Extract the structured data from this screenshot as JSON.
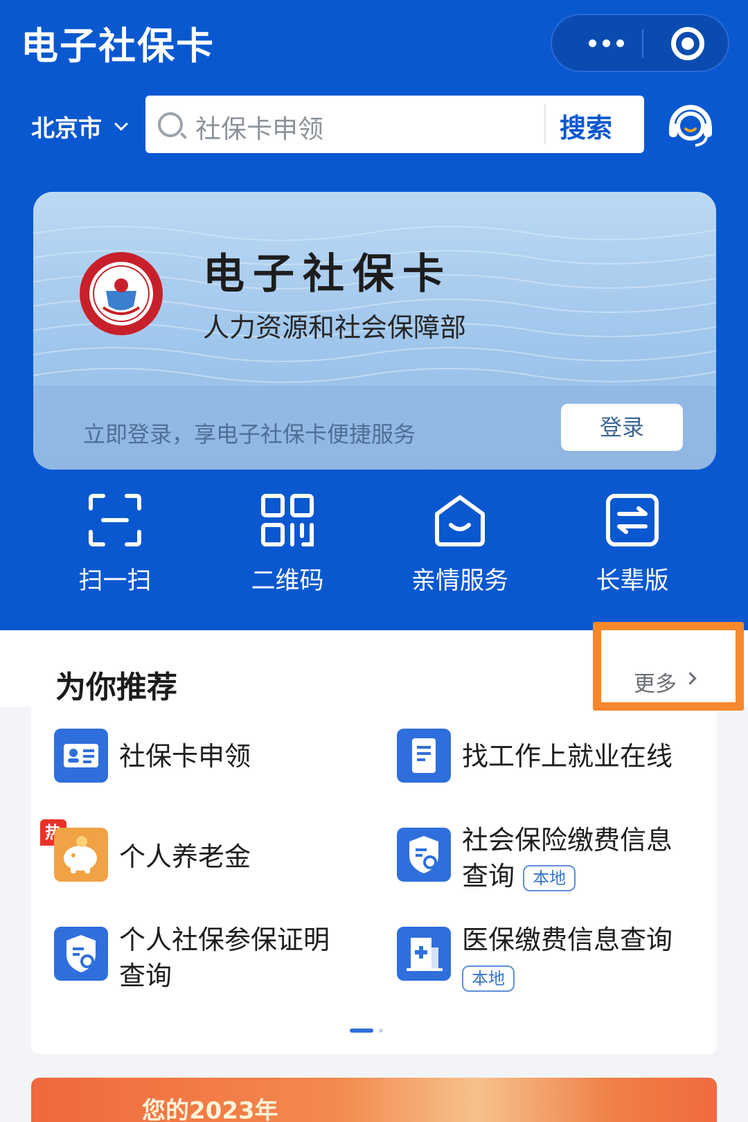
{
  "header": {
    "title": "电子社保卡",
    "menu_icon": "more-dots-icon",
    "close_icon": "target-close-icon"
  },
  "search": {
    "city": "北京市",
    "placeholder": "社保卡申领",
    "button": "搜索"
  },
  "banner": {
    "title": "电子社保卡",
    "subtitle": "人力资源和社会保障部",
    "tip": "立即登录，享电子社保卡便捷服务",
    "login_button": "登录"
  },
  "quick_actions": [
    {
      "label": "扫一扫",
      "icon": "scan-icon"
    },
    {
      "label": "二维码",
      "icon": "qr-code-icon"
    },
    {
      "label": "亲情服务",
      "icon": "family-home-icon"
    },
    {
      "label": "长辈版",
      "icon": "elder-mode-icon"
    }
  ],
  "recommend": {
    "title": "为你推荐",
    "more": "更多",
    "hot_badge": "热",
    "items": [
      {
        "label": "社保卡申领",
        "icon": "id-card-icon"
      },
      {
        "label": "找工作上就业在线",
        "icon": "document-icon"
      },
      {
        "label": "个人养老金",
        "icon": "piggy-bank-icon"
      },
      {
        "label_line1": "社会保险缴费信息",
        "label_line2": "查询",
        "tag": "本地",
        "icon": "shield-search-icon"
      },
      {
        "label_line1": "个人社保参保证明",
        "label_line2": "查询",
        "icon": "shield-search-icon"
      },
      {
        "label": "医保缴费信息查询",
        "tag": "本地",
        "icon": "medical-building-icon"
      }
    ]
  },
  "promo": {
    "text": "您的2023年"
  },
  "colors": {
    "primary": "#0a58d0",
    "highlight": "#f7882b",
    "hot": "#e8332a"
  }
}
